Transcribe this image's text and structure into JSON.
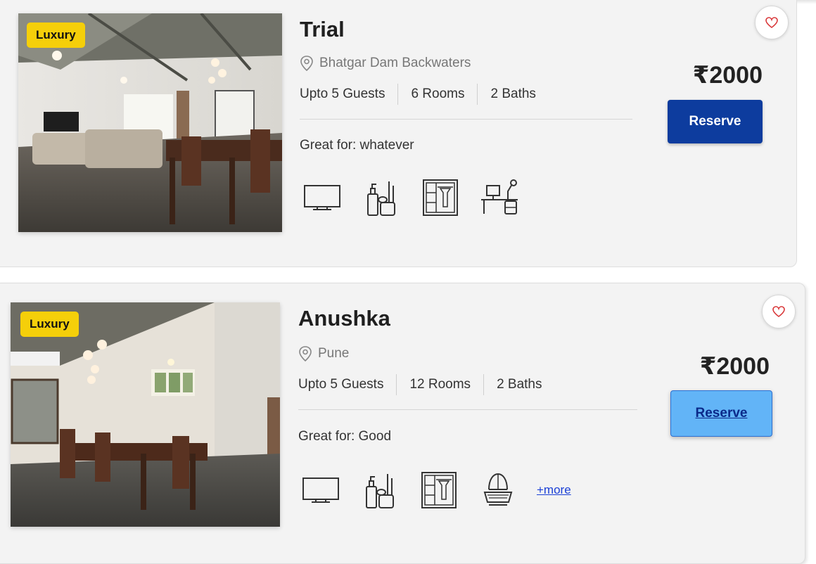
{
  "listings": [
    {
      "badge": "Luxury",
      "title": "Trial",
      "location": "Bhatgar Dam Backwaters",
      "guests": "Upto 5 Guests",
      "rooms": "6 Rooms",
      "baths": "2 Baths",
      "great_for": "Great for: whatever",
      "price": "₹2000",
      "reserve_label": "Reserve",
      "amenities": [
        "tv-icon",
        "toiletries-icon",
        "wardrobe-icon",
        "work-desk-icon"
      ]
    },
    {
      "badge": "Luxury",
      "title": "Anushka",
      "location": "Pune",
      "guests": "Upto 5 Guests",
      "rooms": "12 Rooms",
      "baths": "2 Baths",
      "great_for": "Great for: Good",
      "price": "₹2000",
      "reserve_label": "Reserve",
      "amenities": [
        "tv-icon",
        "toiletries-icon",
        "wardrobe-icon",
        "heater-icon"
      ],
      "more_label": "+more"
    }
  ],
  "colors": {
    "badge": "#f5cf0a",
    "reserve_primary": "#0d3c9e",
    "reserve_hover": "#62b4f7",
    "heart": "#d9383a"
  }
}
